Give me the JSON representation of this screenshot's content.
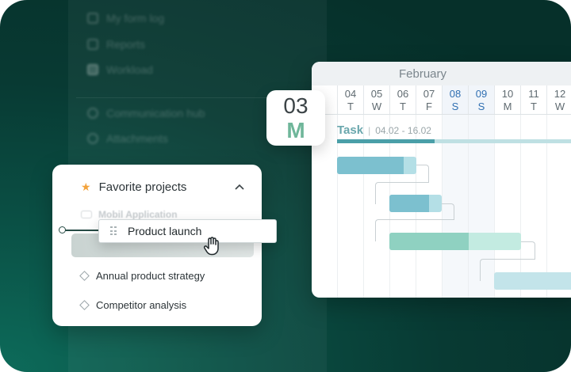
{
  "sidebar_ghost": {
    "items": [
      {
        "label": "My form log",
        "icon": "user-icon"
      },
      {
        "label": "Reports",
        "icon": "document-icon"
      },
      {
        "label": "Workload",
        "icon": "grid-icon"
      },
      {
        "label": "Communication hub",
        "icon": "chat-icon"
      },
      {
        "label": "Attachments",
        "icon": "paperclip-icon"
      }
    ]
  },
  "gantt": {
    "month": "February",
    "days": [
      {
        "num": "04",
        "wd": "T",
        "weekend": false
      },
      {
        "num": "05",
        "wd": "W",
        "weekend": false
      },
      {
        "num": "06",
        "wd": "T",
        "weekend": false
      },
      {
        "num": "07",
        "wd": "F",
        "weekend": false
      },
      {
        "num": "08",
        "wd": "S",
        "weekend": true
      },
      {
        "num": "09",
        "wd": "S",
        "weekend": true
      },
      {
        "num": "10",
        "wd": "M",
        "weekend": false
      },
      {
        "num": "11",
        "wd": "T",
        "weekend": false
      },
      {
        "num": "12",
        "wd": "W",
        "weekend": false
      }
    ],
    "task": {
      "name": "Task",
      "separator": "|",
      "dates": "04.02 - 16.02",
      "progress": 0.4
    },
    "colors": {
      "accent": "#4a9fa8",
      "bar_blue": "#7cc0cf",
      "bar_green": "#8fd1c1",
      "weekend_text": "#2f6fb2"
    }
  },
  "date_badge": {
    "number": "03",
    "weekday": "M"
  },
  "favorites": {
    "title": "Favorite projects",
    "star_icon": "star-icon",
    "collapse_icon": "chevron-up-icon",
    "faded_item": "Mobil Application",
    "projects": [
      "Annual product strategy",
      "Competitor analysis"
    ]
  },
  "drag": {
    "label": "Product launch",
    "handle_icon": "drag-handle-icon",
    "cursor_icon": "grab-hand-icon"
  }
}
